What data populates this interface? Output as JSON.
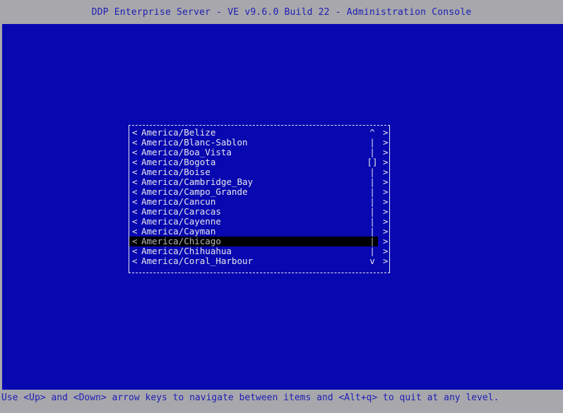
{
  "titlebar": {
    "title": "DDP Enterprise Server - VE v9.6.0 Build 22 - Administration Console"
  },
  "statusbar": {
    "hint": "Use <Up> and <Down> arrow keys to navigate between items and <Alt+q> to quit at any level."
  },
  "colors": {
    "console_background": "#0808b0",
    "chrome_background": "#a8a8ac",
    "chrome_text": "#1d1db4",
    "console_text": "#e6e6ee",
    "selection_background": "#000000",
    "selection_text": "#b8b8b8"
  },
  "menu": {
    "left_marker": "<",
    "right_marker": ">",
    "scroll_up_glyph": "^",
    "scroll_down_glyph": "v",
    "scroll_track_glyph": "|",
    "scroll_thumb_glyph": "[]",
    "selected_index": 11,
    "items": [
      {
        "label": "America/Belize",
        "scroll": "^"
      },
      {
        "label": "America/Blanc-Sablon",
        "scroll": "|"
      },
      {
        "label": "America/Boa_Vista",
        "scroll": "|"
      },
      {
        "label": "America/Bogota",
        "scroll": "[]"
      },
      {
        "label": "America/Boise",
        "scroll": "|"
      },
      {
        "label": "America/Cambridge_Bay",
        "scroll": "|"
      },
      {
        "label": "America/Campo_Grande",
        "scroll": "|"
      },
      {
        "label": "America/Cancun",
        "scroll": "|"
      },
      {
        "label": "America/Caracas",
        "scroll": "|"
      },
      {
        "label": "America/Cayenne",
        "scroll": "|"
      },
      {
        "label": "America/Cayman",
        "scroll": "|"
      },
      {
        "label": "America/Chicago",
        "scroll": "|"
      },
      {
        "label": "America/Chihuahua",
        "scroll": "|"
      },
      {
        "label": "America/Coral_Harbour",
        "scroll": "v"
      }
    ]
  }
}
